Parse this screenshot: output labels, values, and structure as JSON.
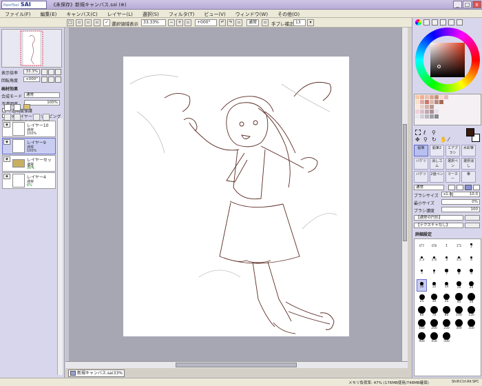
{
  "app": {
    "logo_small": "PaintTool",
    "logo_big": "SAI",
    "title": "《未保存》新規キャンバス.sai (⊕)",
    "window_controls": [
      "_",
      "□",
      "x"
    ]
  },
  "menu": [
    "ファイル(F)",
    "編集(E)",
    "キャンバス(C)",
    "レイヤー(L)",
    "選択(S)",
    "フィルタ(T)",
    "ビュー(V)",
    "ウィンドウ(W)",
    "その他(O)"
  ],
  "toolbar": {
    "selection_show_label": "選択領域表示",
    "zoom": "33.33%",
    "rotation": "+000°",
    "mode": "通常",
    "stabilizer_label": "手ブレ補正",
    "stabilizer_value": "13"
  },
  "left_panel": {
    "zoom_label": "表示倍率",
    "zoom_value": "33.3%",
    "rotation_label": "回転角度",
    "rotation_value": "+000°",
    "texture_label": "画材効果",
    "blend_label": "合成モード",
    "blend_value": "通常",
    "opacity_label": "不透明度",
    "opacity_value": "100%",
    "options": [
      "不透明度保護",
      "下のレイヤーでクリッピング",
      "領域検出元に指定"
    ],
    "layers": [
      {
        "name": "レイヤー10",
        "mode": "通常",
        "opacity": "100%",
        "selected": false
      },
      {
        "name": "レイヤー9",
        "mode": "通常",
        "opacity": "100%",
        "selected": true
      },
      {
        "name": "レイヤーセット1",
        "mode": "通常",
        "opacity": "16%",
        "selected": false
      },
      {
        "name": "レイヤー4",
        "mode": "通常",
        "opacity": "6%",
        "selected": false
      }
    ]
  },
  "document_tab": {
    "name": "新規キャンバス.sai",
    "zoom": "33%"
  },
  "status": {
    "memory": "メモリ負荷率: 47% (176MB使用/748MB確保)",
    "keys": [
      "Shift",
      "Ctrl",
      "Alt",
      "SPC",
      "Any"
    ]
  },
  "right_panel": {
    "tools_row1": [
      "鉛筆",
      "鉛筆2",
      "エアブラシ",
      "水彩筆"
    ],
    "tools_row2": [
      "バケツ",
      "消しゴム",
      "選択ペン",
      "選択消し"
    ],
    "tools_row3": [
      "バケツ",
      "2値ペン",
      "マーカー",
      "筆"
    ],
    "brush_mode": "通常",
    "brush_size_label": "ブラシサイズ",
    "brush_size_mult": "x1.0",
    "brush_size_value": "10.0",
    "min_size_label": "最小サイズ",
    "min_size_value": "0%",
    "density_label": "ブラシ濃度",
    "density_value": "100",
    "shape_value": "【通常の円形】",
    "texture_value": "【テクスチャなし】",
    "detail_label": "詳細設定",
    "brush_sizes": [
      "0.7",
      "0.8",
      "1",
      "1.5",
      "2",
      "2.3",
      "2.6",
      "3",
      "3.5",
      "4",
      "5",
      "6",
      "7",
      "8",
      "9",
      "10",
      "12",
      "14",
      "16",
      "20",
      "25",
      "30",
      "35",
      "40",
      "50",
      "60",
      "70",
      "80",
      "100",
      "120",
      "160",
      "200",
      "250",
      "300",
      "350",
      "400",
      "450",
      "500"
    ],
    "fg_color": "#3a1a0e",
    "bg_color": "#ffffff"
  }
}
